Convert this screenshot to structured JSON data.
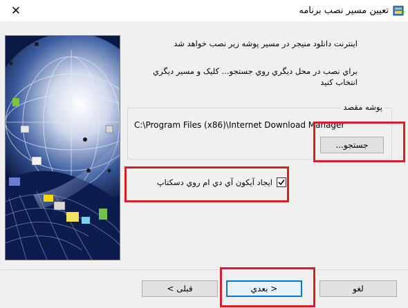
{
  "window": {
    "title": "تعيين مسير نصب برنامه",
    "close_label": "✕"
  },
  "content": {
    "message_line1": "اينترنت دانلود منيجر در مسير پوشه زير نصب خواهد شد",
    "message_line2": "براي نصب در محل ديگري روي جستجو... کليک و مسير ديگري",
    "message_line3": "انتخاب کنيد"
  },
  "destination": {
    "legend": "پوشه مقصد",
    "path": "C:\\Program Files (x86)\\Internet Download Manager",
    "browse_label": "جستجو..."
  },
  "options": {
    "desktop_icon_label": "ايجاد آيکون آي دي ام روي دسکتاپ",
    "desktop_icon_checked": true
  },
  "footer": {
    "back_label": "قبلی >",
    "next_label": "< بعدي",
    "cancel_label": "لغو"
  }
}
